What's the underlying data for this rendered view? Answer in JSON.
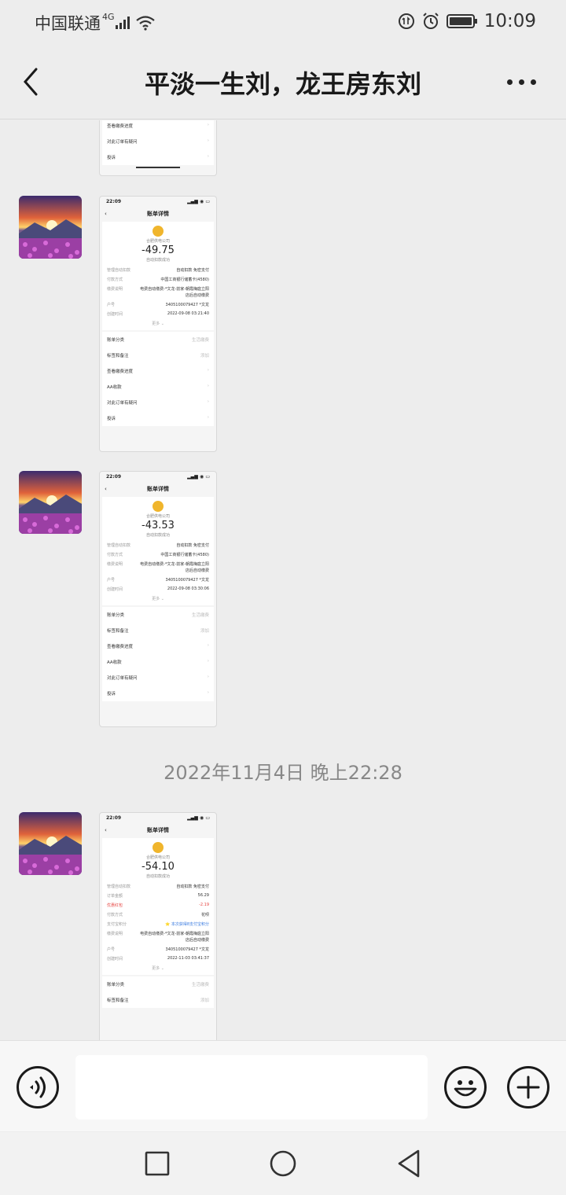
{
  "status": {
    "carrier": "中国联通",
    "network": "4G",
    "time": "10:09"
  },
  "header": {
    "title": "平淡一生刘，龙王房东刘"
  },
  "messages": [
    {
      "status_time": "",
      "page_title": "",
      "rows": [],
      "list": [
        "查看缴费进度",
        "对此订单有疑问",
        "投诉"
      ]
    },
    {
      "status_time": "22:09",
      "page_title": "账单详情",
      "merchant": "合肥供电公司",
      "amount": "-49.75",
      "status_text": "自动扣款成功",
      "rows": [
        {
          "k": "管理自动扣款",
          "v": "自动扣款 免密支付"
        },
        {
          "k": "付款方式",
          "v": "中国工商银行储蓄卡(4580)"
        },
        {
          "k": "缴费说明",
          "v": "电费自动缴费-*文龙-前家-朝霞梅庭立阳"
        },
        {
          "k": "",
          "v": "店后自动缴费"
        },
        {
          "k": "户号",
          "v": "3405100079427 *文龙"
        },
        {
          "k": "创建时间",
          "v": "2022-09-08 03:21:40"
        }
      ],
      "more": "更多 ⌄",
      "list": [
        {
          "l": "账单分类",
          "r": "生活缴费"
        },
        {
          "l": "标签和备注",
          "r": "添加"
        },
        {
          "l": "查看缴费进度",
          "r": ""
        },
        {
          "l": "AA收款",
          "r": ""
        },
        {
          "l": "对此订单有疑问",
          "r": ""
        },
        {
          "l": "投诉",
          "r": ""
        }
      ]
    },
    {
      "status_time": "22:09",
      "page_title": "账单详情",
      "merchant": "合肥供电公司",
      "amount": "-43.53",
      "status_text": "自动扣款成功",
      "rows": [
        {
          "k": "管理自动扣款",
          "v": "自动扣款 免密支付"
        },
        {
          "k": "付款方式",
          "v": "中国工商银行储蓄卡(4580)"
        },
        {
          "k": "缴费说明",
          "v": "电费自动缴费-*文龙-前家-朝霞梅庭立阳"
        },
        {
          "k": "",
          "v": "店后自动缴费"
        },
        {
          "k": "户号",
          "v": "3405100079427 *文龙"
        },
        {
          "k": "创建时间",
          "v": "2022-09-08 03:30:06"
        }
      ],
      "more": "更多 ⌄",
      "list": [
        {
          "l": "账单分类",
          "r": "生活缴费"
        },
        {
          "l": "标签和备注",
          "r": "添加"
        },
        {
          "l": "查看缴费进度",
          "r": ""
        },
        {
          "l": "AA收款",
          "r": ""
        },
        {
          "l": "对此订单有疑问",
          "r": ""
        },
        {
          "l": "投诉",
          "r": ""
        }
      ]
    },
    {
      "status_time": "22:09",
      "page_title": "账单详情",
      "merchant": "合肥供电公司",
      "amount": "-54.10",
      "status_text": "自动扣款成功",
      "rows": [
        {
          "k": "管理自动扣款",
          "v": "自动扣款 免密支付",
          "c": ""
        },
        {
          "k": "订单金额",
          "v": "56.29",
          "c": ""
        },
        {
          "k": "优惠红包",
          "v": "-2.19",
          "c": "red"
        },
        {
          "k": "付款方式",
          "v": "花呗",
          "c": ""
        },
        {
          "k": "支付宝积分",
          "v": "⭐ 本次获得8支付宝积分",
          "c": ""
        },
        {
          "k": "缴费说明",
          "v": "电费自动缴费-*文龙-前家-朝霞梅庭立阳",
          "c": ""
        },
        {
          "k": "",
          "v": "店后自动缴费",
          "c": ""
        },
        {
          "k": "户号",
          "v": "3405100079427 *文龙",
          "c": ""
        },
        {
          "k": "创建时间",
          "v": "2022-11-03 03:41:37",
          "c": ""
        }
      ],
      "more": "更多 ⌄",
      "list": [
        {
          "l": "账单分类",
          "r": "生活缴费"
        },
        {
          "l": "标签和备注",
          "r": "添加"
        }
      ]
    }
  ],
  "timestamp": "2022年11月4日 晚上22:28",
  "colors": {
    "bg": "#ededed",
    "coin": "#f0b52c",
    "red": "#e64340"
  }
}
